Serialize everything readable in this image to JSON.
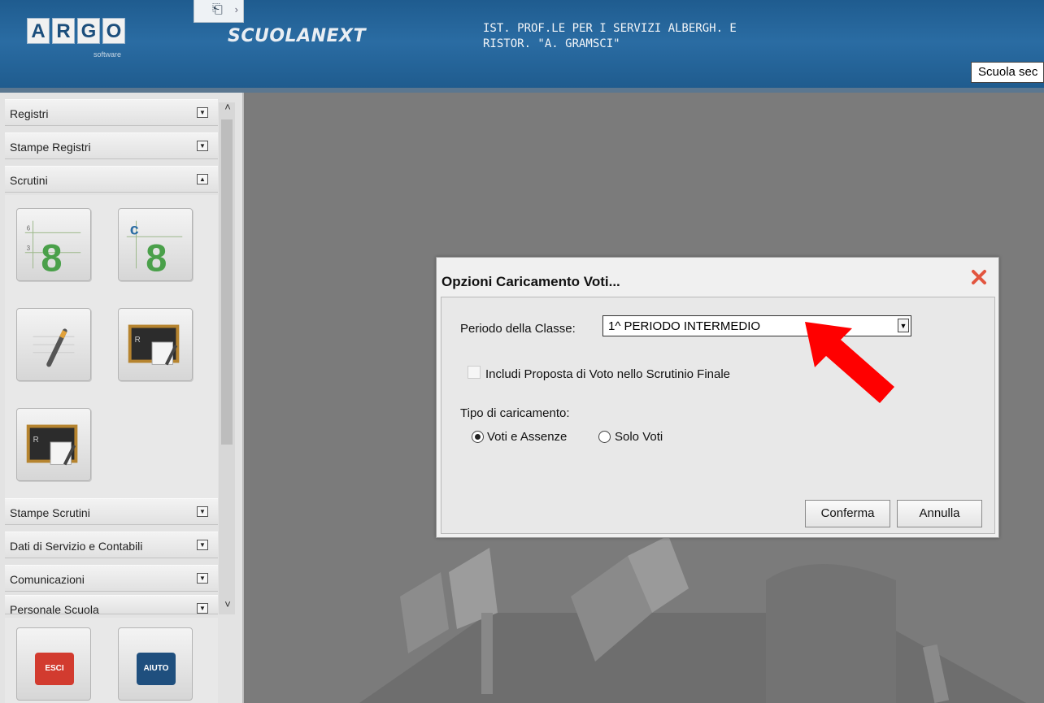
{
  "header": {
    "logo_letters": [
      "A",
      "R",
      "G",
      "O"
    ],
    "logo_sub": "software",
    "product_name": "SCUOLANEXT",
    "school_name": "IST. PROF.LE PER I SERVIZI ALBERGH. E\nRISTOR. \"A. GRAMSCI\"",
    "school_select_value": "Scuola sec"
  },
  "sidebar": {
    "menu": [
      {
        "label": "Registri"
      },
      {
        "label": "Stampe Registri"
      },
      {
        "label": "Scrutini"
      },
      {
        "label": "Stampe Scrutini"
      },
      {
        "label": "Dati di Servizio e Contabili"
      },
      {
        "label": "Comunicazioni"
      },
      {
        "label": "Personale Scuola"
      }
    ],
    "buttons": [
      {
        "label": "ESCI",
        "color": "#d23b2f"
      },
      {
        "label": "AIUTO",
        "color": "#1f4f7e"
      }
    ]
  },
  "dialog": {
    "title": "Opzioni Caricamento Voti...",
    "period_label": "Periodo della Classe:",
    "period_value": "1^ PERIODO INTERMEDIO",
    "include_label": "Includi Proposta di Voto nello Scrutinio Finale",
    "include_checked": false,
    "load_type_label": "Tipo di caricamento:",
    "option_votes_absences": "Voti e Assenze",
    "option_votes_only": "Solo Voti",
    "selected_option": "Voti e Assenze",
    "confirm_label": "Conferma",
    "cancel_label": "Annulla"
  },
  "colors": {
    "header_blue": "#2a6ca3",
    "close_red": "#e2553f",
    "annotation_arrow": "#ff0000"
  }
}
